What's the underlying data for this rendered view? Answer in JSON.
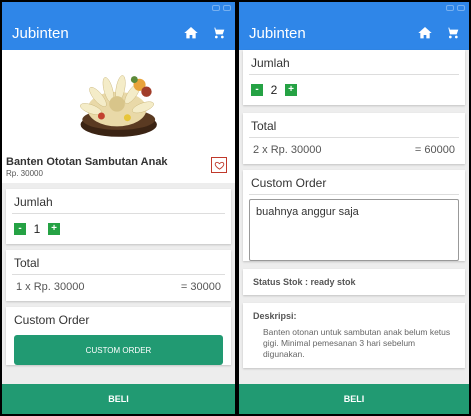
{
  "app": {
    "title": "Jubinten"
  },
  "icons": {
    "home": "home-icon",
    "cart": "cart-icon",
    "favorite": "heart-icon"
  },
  "colors": {
    "appbar": "#2f86e8",
    "buy": "#219a72",
    "stepper": "#25a244",
    "favorite_border": "#c0392b"
  },
  "product": {
    "name": "Banten Ototan Sambutan Anak",
    "price": "Rp. 30000"
  },
  "left": {
    "jumlah_label": "Jumlah",
    "qty": "1",
    "minus": "-",
    "plus": "+",
    "total_label": "Total",
    "total_formula": "1 x Rp. 30000",
    "total_value": "= 30000",
    "custom_label": "Custom Order",
    "custom_button": "CUSTOM ORDER",
    "buy": "BELI"
  },
  "right": {
    "jumlah_label": "Jumlah",
    "qty": "2",
    "minus": "-",
    "plus": "+",
    "total_label": "Total",
    "total_formula": "2 x Rp. 30000",
    "total_value": "= 60000",
    "custom_label": "Custom Order",
    "custom_text": "buahnya anggur saja",
    "status": "Status Stok :  ready stok",
    "desc_title": "Deskripsi:",
    "desc_text": "Banten otonan untuk sambutan anak belum ketus gigi. Minimal pemesanan 3 hari sebelum digunakan.",
    "buy": "BELI"
  }
}
